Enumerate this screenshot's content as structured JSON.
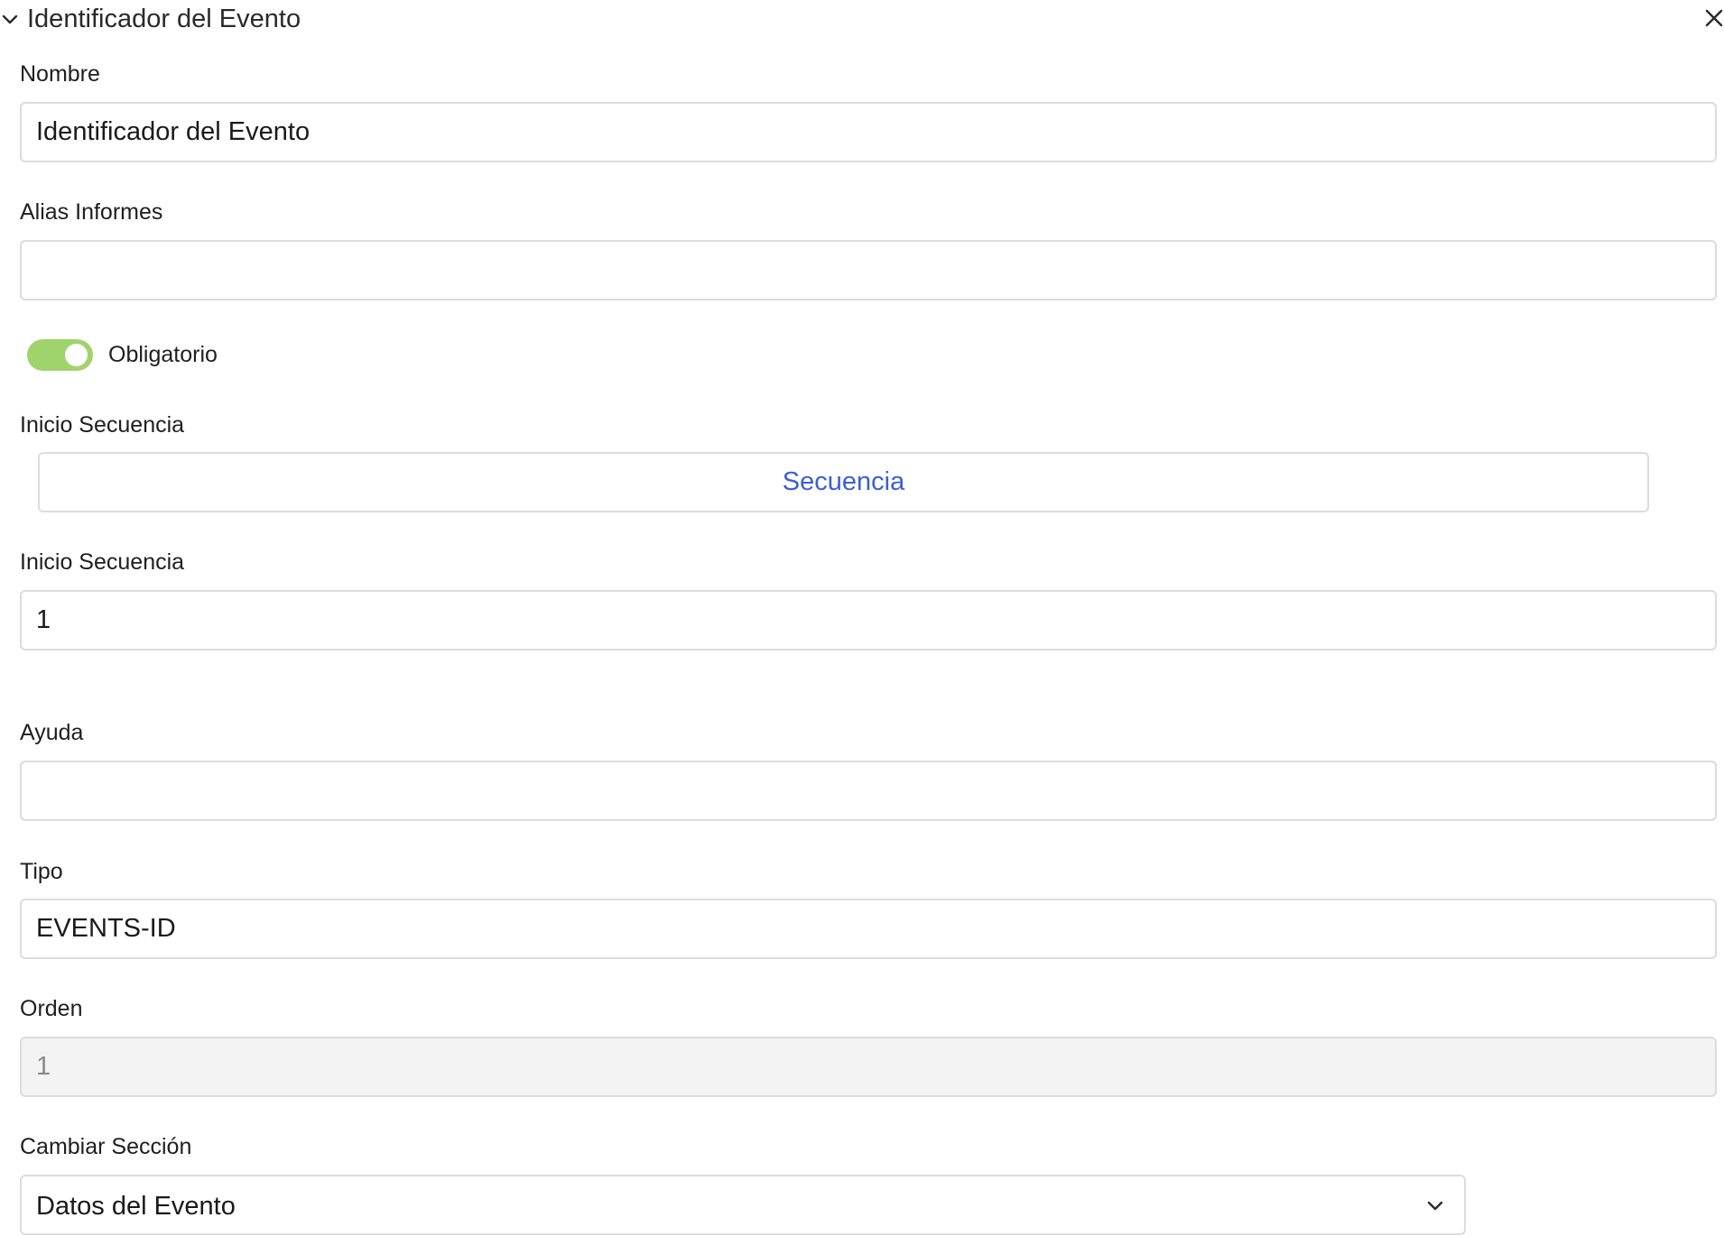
{
  "header": {
    "title": "Identificador del Evento",
    "collapse_icon": "chevron-down-icon",
    "close_icon": "close-icon"
  },
  "fields": {
    "nombre": {
      "label": "Nombre",
      "value": "Identificador del Evento"
    },
    "alias_informes": {
      "label": "Alias Informes",
      "value": ""
    },
    "obligatorio": {
      "label": "Obligatorio",
      "checked": true,
      "color": "#9fd36b"
    },
    "inicio_secuencia_button": {
      "label": "Inicio Secuencia",
      "button_label": "Secuencia"
    },
    "inicio_secuencia_value": {
      "label": "Inicio Secuencia",
      "value": "1"
    },
    "ayuda": {
      "label": "Ayuda",
      "value": ""
    },
    "tipo": {
      "label": "Tipo",
      "value": "EVENTS-ID"
    },
    "orden": {
      "label": "Orden",
      "value": "1",
      "disabled": true
    },
    "cambiar_seccion": {
      "label": "Cambiar Sección",
      "selected": "Datos del Evento"
    }
  },
  "colors": {
    "accent_link": "#3a5fd6",
    "toggle_on": "#9fd36b",
    "border": "#dcdcdc",
    "disabled_bg": "#f3f3f3"
  }
}
